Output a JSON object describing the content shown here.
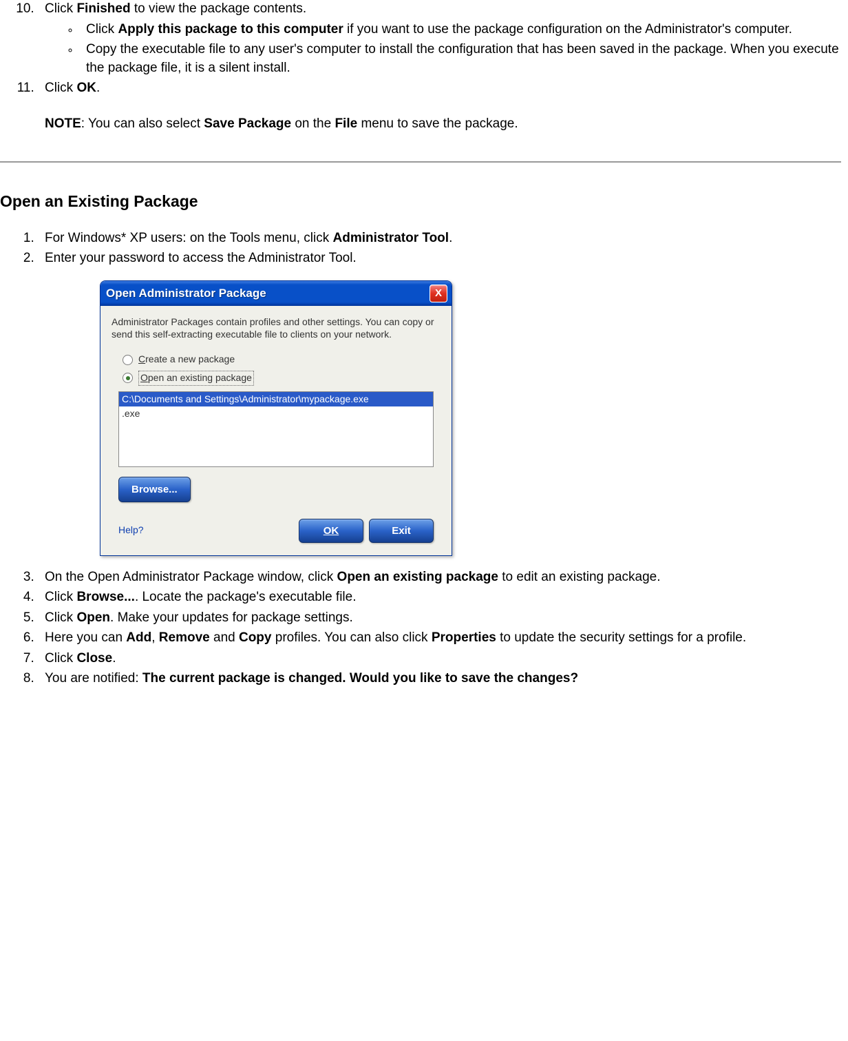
{
  "section1": {
    "step10": {
      "prefix": "Click ",
      "bold": "Finished",
      "suffix": " to view the package contents.",
      "sub1_prefix": "Click ",
      "sub1_bold": "Apply this package to this computer",
      "sub1_suffix": " if you want to use the package configuration on the Administrator's computer.",
      "sub2": "Copy the executable file to any user's computer to install the configuration that has been saved in the package. When you execute the package file, it is a silent install."
    },
    "step11": {
      "prefix": "Click ",
      "bold": "OK",
      "suffix": ".",
      "note_bold": "NOTE",
      "note_mid1": ": You can also select ",
      "note_bold2": "Save Package",
      "note_mid2": " on the ",
      "note_bold3": "File",
      "note_suffix": " menu to save the package."
    }
  },
  "heading": "Open an Existing Package",
  "section2": {
    "step1_prefix": "For Windows* XP users: on the Tools menu, click ",
    "step1_bold": "Administrator Tool",
    "step1_suffix": ".",
    "step2": "Enter your password to access the Administrator Tool.",
    "step3_prefix": "On the Open Administrator Package window, click ",
    "step3_bold": "Open an existing package",
    "step3_suffix": " to edit an existing package.",
    "step4_prefix": "Click ",
    "step4_bold": "Browse...",
    "step4_suffix": ". Locate the package's executable file.",
    "step5_prefix": "Click ",
    "step5_bold": "Open",
    "step5_suffix": ". Make your updates for package settings.",
    "step6_prefix": "Here you can ",
    "step6_bold1": "Add",
    "step6_mid1": ", ",
    "step6_bold2": "Remove",
    "step6_mid2": " and ",
    "step6_bold3": "Copy",
    "step6_mid3": " profiles. You can also click ",
    "step6_bold4": "Properties",
    "step6_suffix": " to update the security settings for a profile.",
    "step7_prefix": "Click ",
    "step7_bold": "Close",
    "step7_suffix": ".",
    "step8_prefix": "You are notified: ",
    "step8_bold": "The current package is changed. Would you like to save the changes?"
  },
  "dialog": {
    "title": "Open Administrator Package",
    "close": "X",
    "description": "Administrator Packages contain profiles and other settings. You can copy or send this self-extracting executable file to clients on your network.",
    "radio1_underline": "C",
    "radio1_rest": "reate a new package",
    "radio2_underline": "O",
    "radio2_rest": "pen an existing package",
    "list_item1": "C:\\Documents and Settings\\Administrator\\mypackage.exe",
    "list_item2": ".exe",
    "browse": "Browse...",
    "help": "Help?",
    "ok": "OK",
    "exit": "Exit"
  }
}
